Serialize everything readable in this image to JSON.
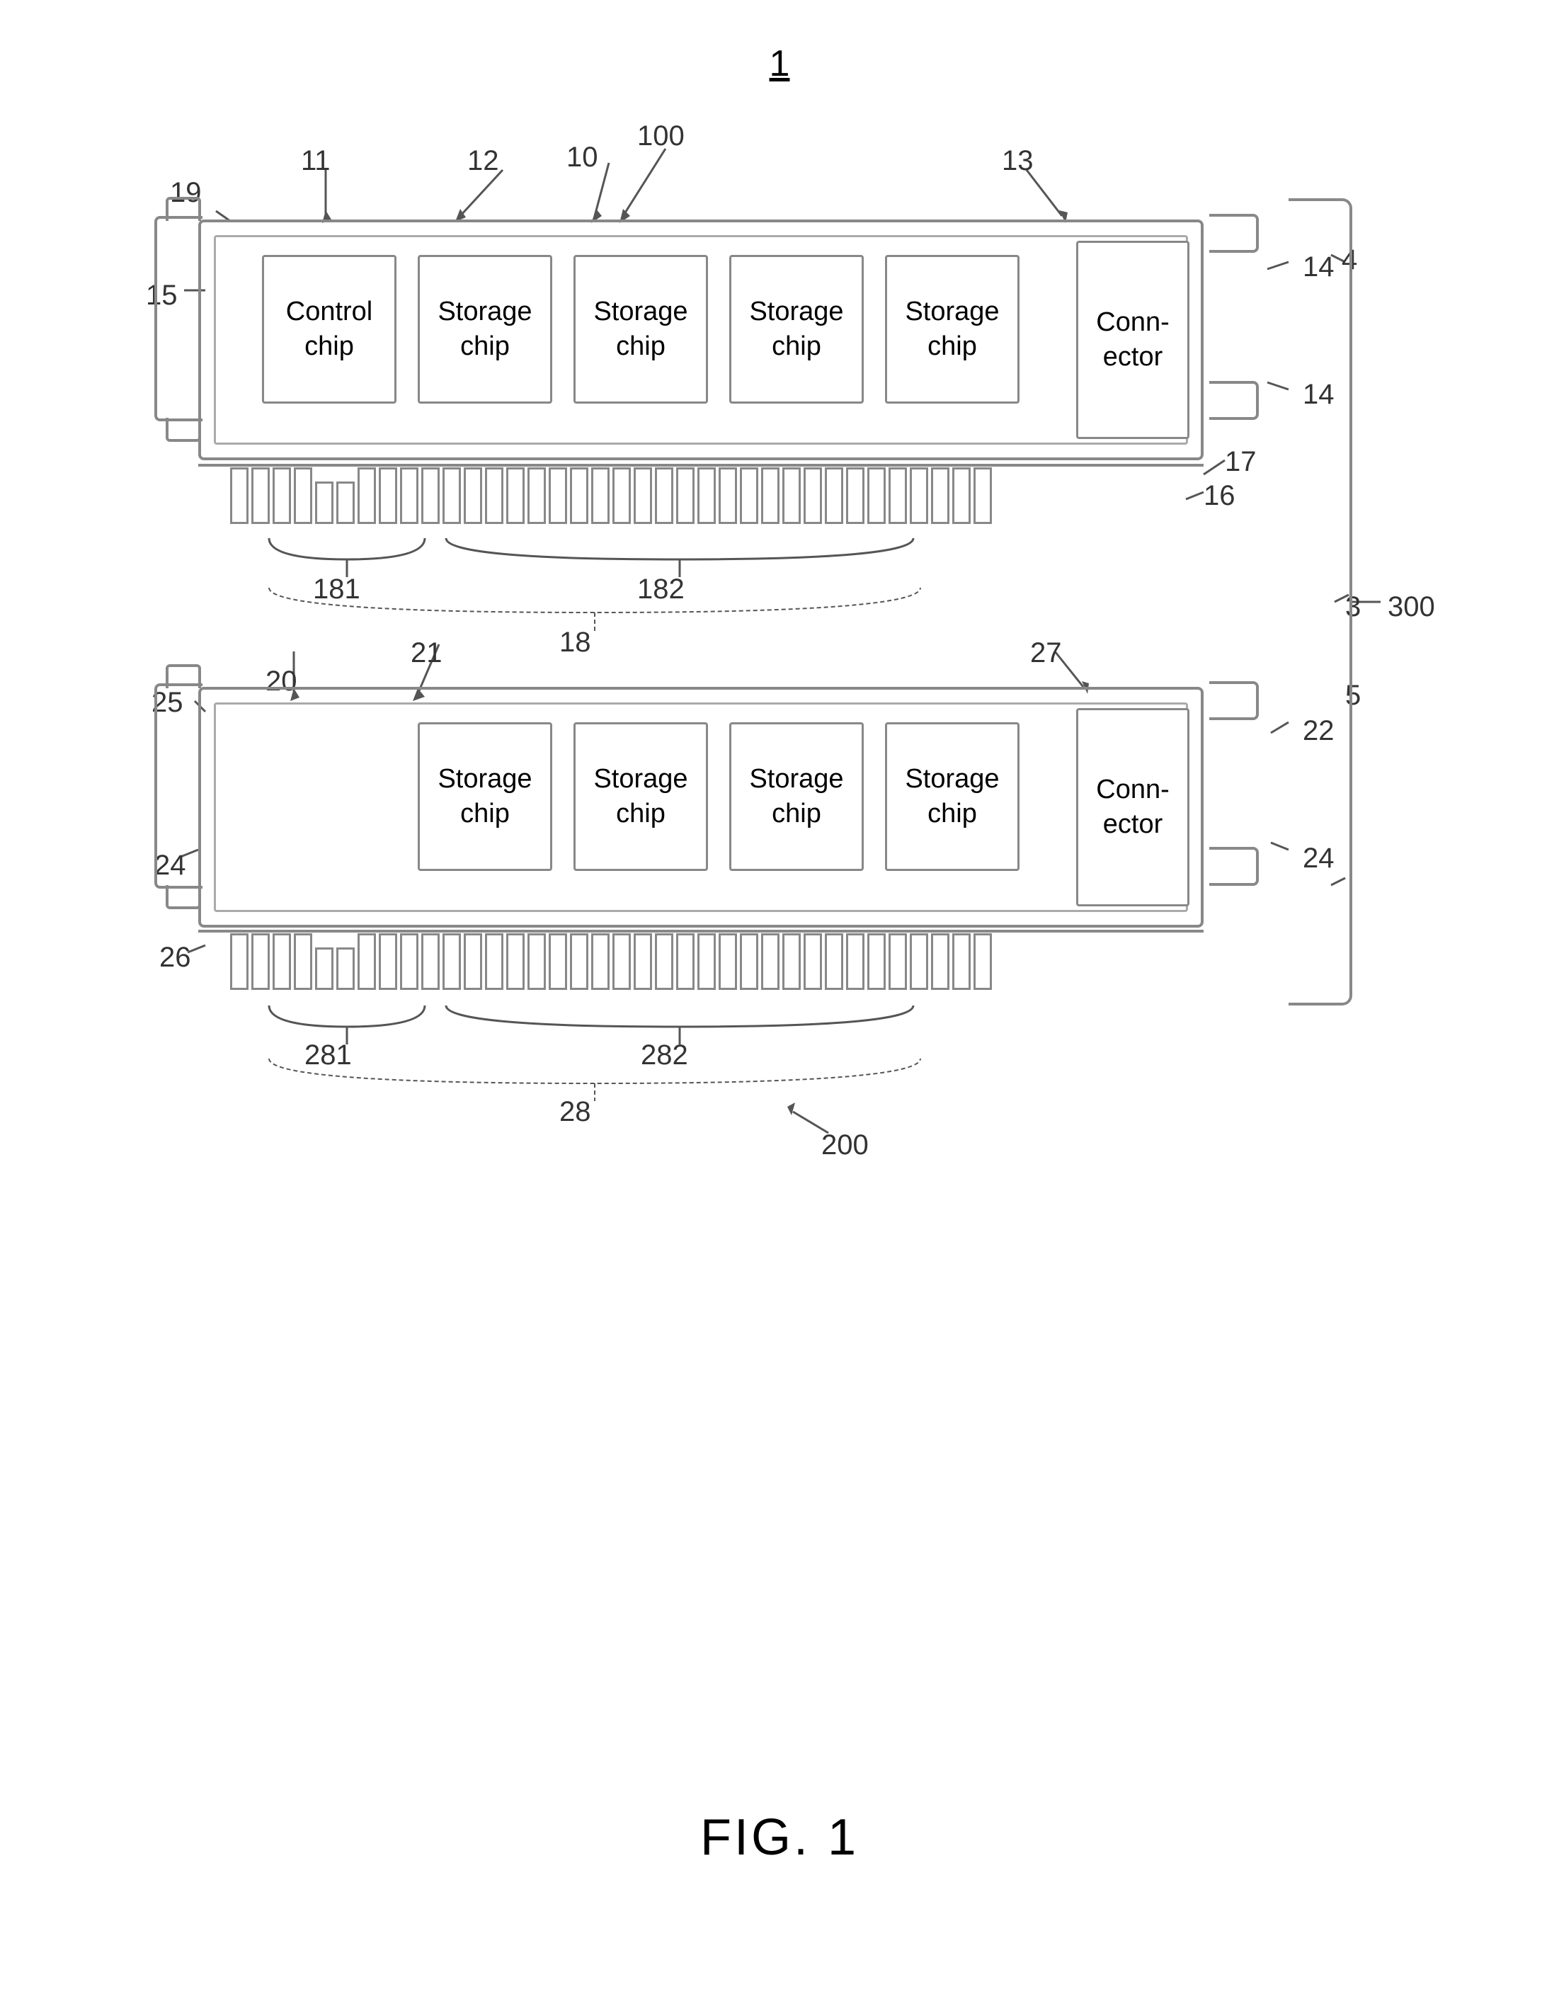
{
  "page": {
    "fig_number_top": "1",
    "fig_caption": "FIG. 1"
  },
  "diagram": {
    "module100": {
      "label": "100",
      "inner_label": "10",
      "pcb_label": "11",
      "chip_group_label": "12",
      "connector_label": "13",
      "right_clip_label": "14",
      "left_bracket_label": "15",
      "notch_label_top": "19",
      "teeth_label_left": "181",
      "teeth_label_right": "182",
      "teeth_group_label": "18",
      "pcb_bottom_label": "16",
      "right_edge_label": "17",
      "left_label_14": "14",
      "control_chip_text": "Control chip",
      "storage_chip_text": "Storage chip",
      "connector_text": "Conn-\nector"
    },
    "module200": {
      "label": "200",
      "inner_label": "20",
      "pcb_label": "21",
      "connector_label": "27",
      "right_clip_label": "22",
      "left_bracket_label": "25",
      "left_edge_label": "26",
      "teeth_label_left": "281",
      "teeth_label_right": "282",
      "teeth_group_label": "28",
      "right_label_24": "24",
      "left_label_24": "24",
      "storage_chip_text": "Storage chip",
      "connector_text": "Conn-\nector",
      "notch_label": "25"
    },
    "outer": {
      "bracket_label": "300",
      "top_label": "4",
      "mid_label": "3",
      "bot_label": "5"
    },
    "shared": {
      "label_3": "3",
      "label_4": "4",
      "label_5": "5"
    }
  }
}
